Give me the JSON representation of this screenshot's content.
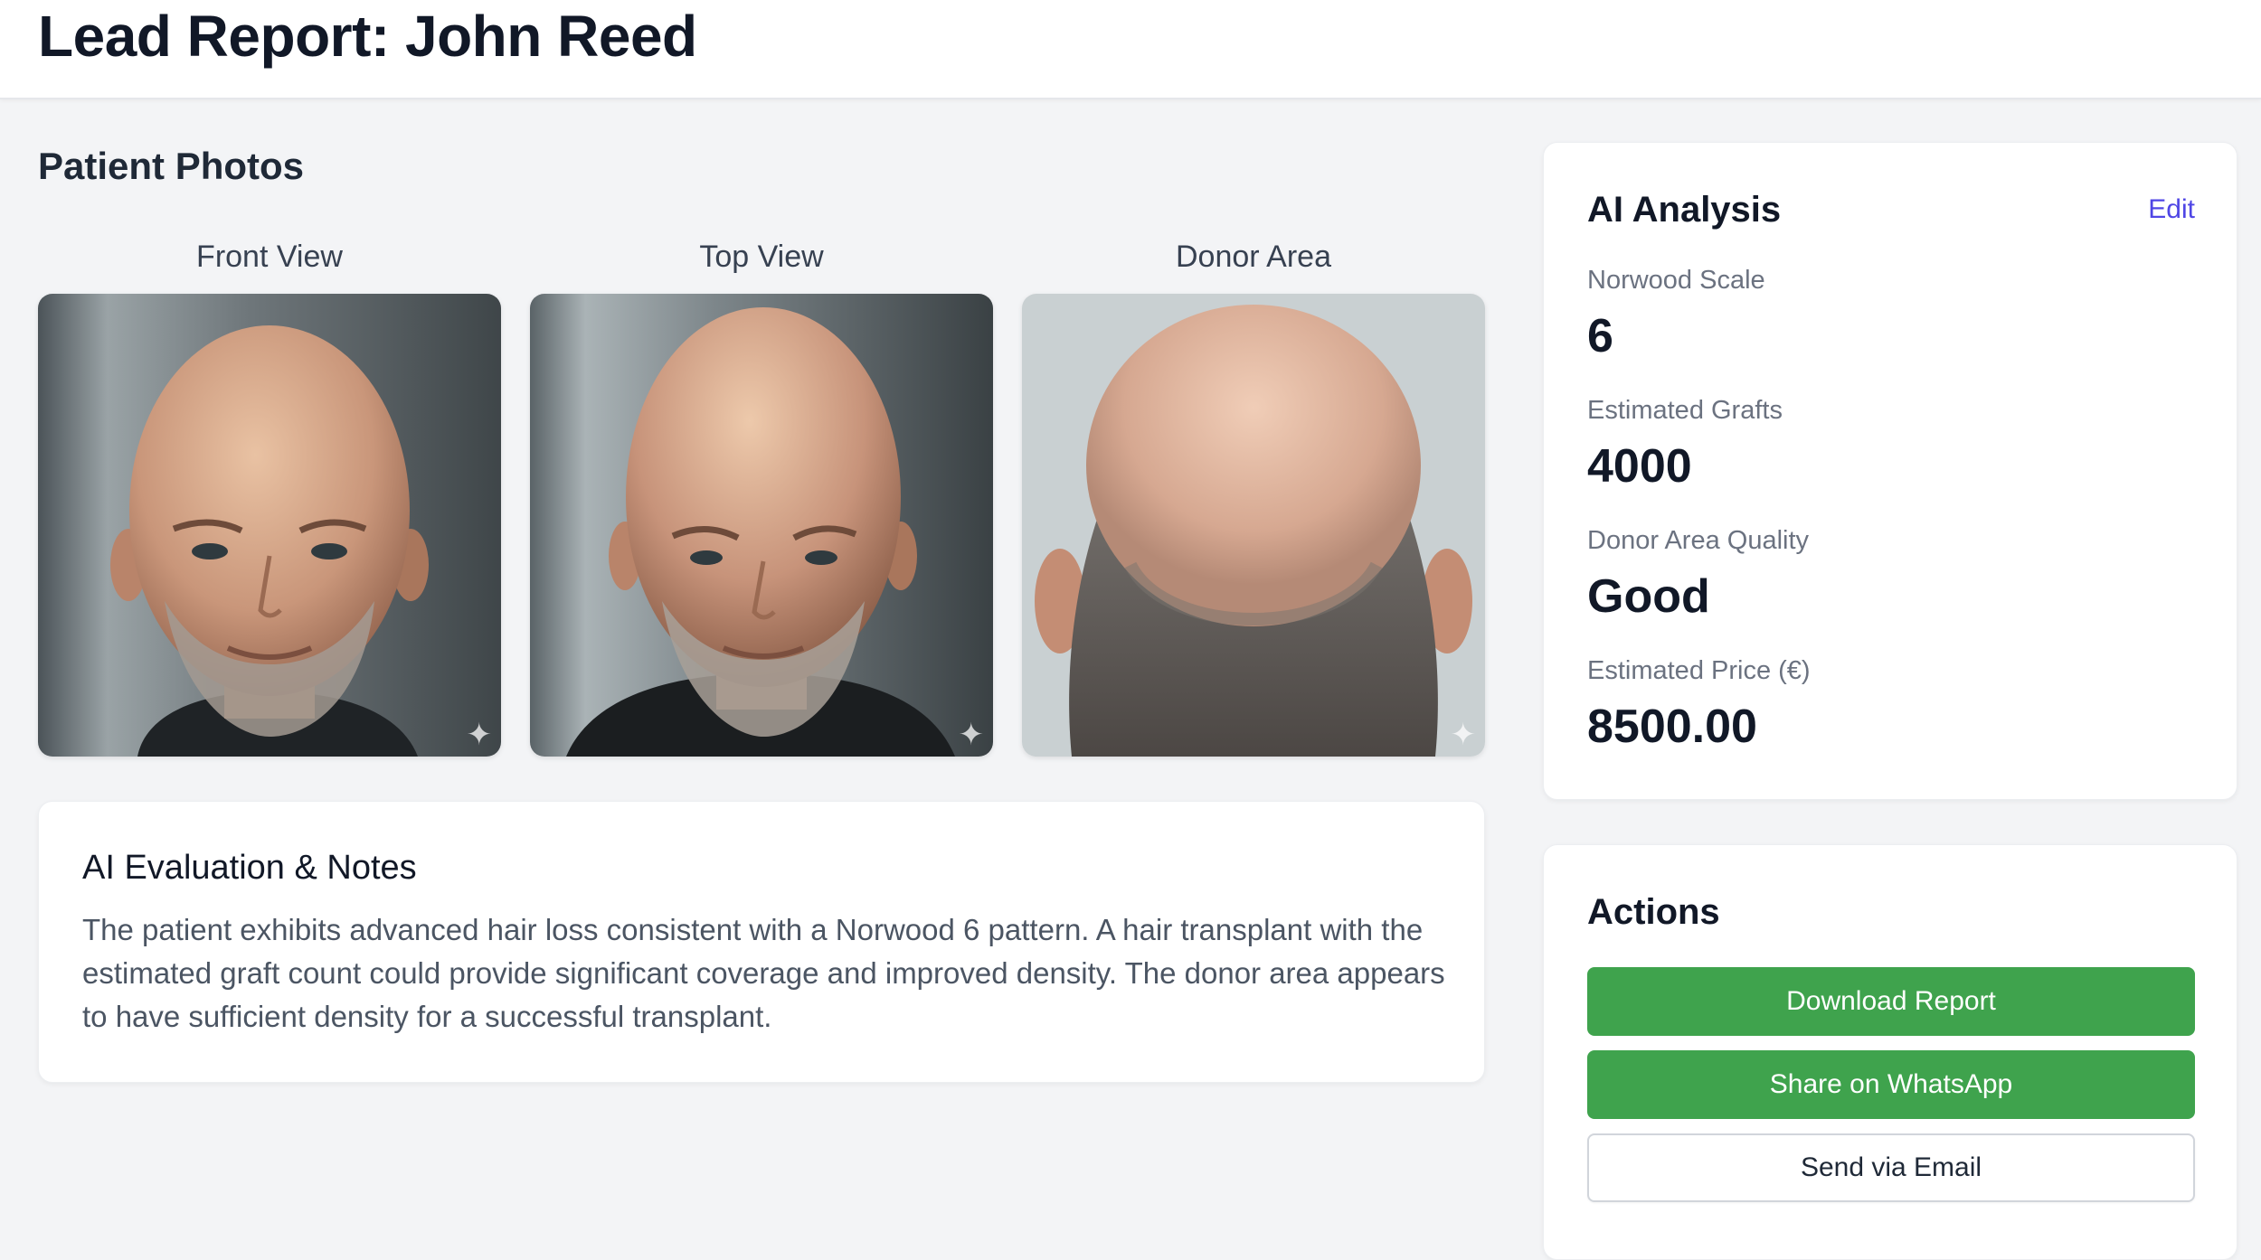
{
  "header": {
    "title": "Lead Report: John Reed"
  },
  "photos": {
    "section_title": "Patient Photos",
    "items": [
      {
        "label": "Front View"
      },
      {
        "label": "Top View"
      },
      {
        "label": "Donor Area"
      }
    ]
  },
  "notes": {
    "title": "AI Evaluation & Notes",
    "body": "The patient exhibits advanced hair loss consistent with a Norwood 6 pattern. A hair transplant with the estimated graft count could provide significant coverage and improved density. The donor area appears to have sufficient density for a successful transplant."
  },
  "analysis": {
    "title": "AI Analysis",
    "edit_label": "Edit",
    "metrics": [
      {
        "label": "Norwood Scale",
        "value": "6"
      },
      {
        "label": "Estimated Grafts",
        "value": "4000"
      },
      {
        "label": "Donor Area Quality",
        "value": "Good"
      },
      {
        "label": "Estimated Price (€)",
        "value": "8500.00"
      }
    ]
  },
  "actions": {
    "title": "Actions",
    "download_label": "Download Report",
    "whatsapp_label": "Share on WhatsApp",
    "email_label": "Send via Email"
  },
  "colors": {
    "primary_green": "#3fa34d",
    "link_indigo": "#4f46e5",
    "page_bg": "#f3f4f6"
  },
  "icons": {
    "photo_badge": "sparkle-icon"
  }
}
